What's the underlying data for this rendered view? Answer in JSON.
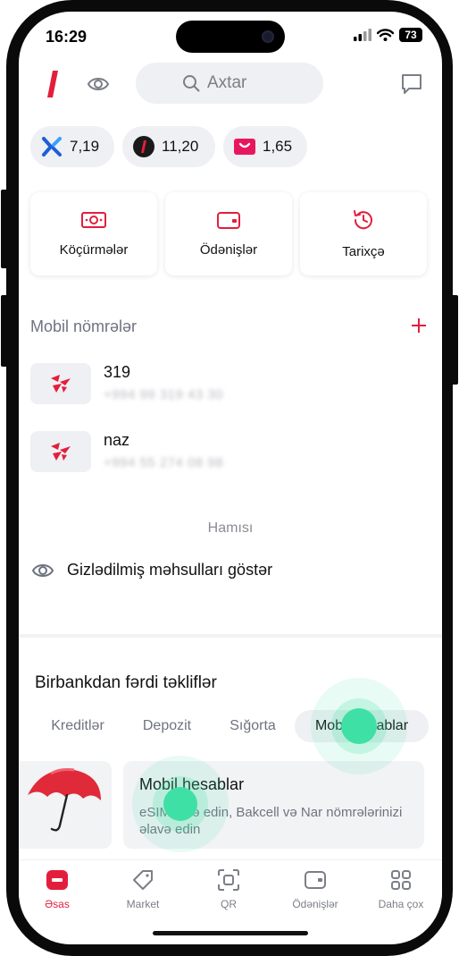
{
  "status_bar": {
    "time": "16:29",
    "battery": "73"
  },
  "header": {
    "logo_icon": "birbank-logo-icon",
    "visibility_icon": "eye-icon",
    "search_placeholder": "Axtar",
    "chat_icon": "chat-bubble-icon"
  },
  "balances": [
    {
      "icon": "crossing-arrows-icon",
      "value": "7,19"
    },
    {
      "icon": "birbank-round-icon",
      "value": "11,20"
    },
    {
      "icon": "red-gift-icon",
      "value": "1,65"
    }
  ],
  "actions": [
    {
      "label": "Köçürmələr",
      "icon": "money-transfer-icon"
    },
    {
      "label": "Ödənişlər",
      "icon": "wallet-icon"
    },
    {
      "label": "Tarixçə",
      "icon": "history-icon"
    }
  ],
  "mobile_numbers": {
    "title": "Mobil nömrələr",
    "items": [
      {
        "name": "319",
        "number": "+994 99 319 43 30"
      },
      {
        "name": "naz",
        "number": "+994 55 274 08 98"
      }
    ],
    "all_label": "Hamısı",
    "hidden_products_label": "Gizlədilmiş məhsulları göstər"
  },
  "offers": {
    "title": "Birbankdan fərdi təkliflər",
    "chips": [
      "Kreditlər",
      "Depozit",
      "Sığorta",
      "Mobil hesablar"
    ],
    "active_chip": "Mobil hesablar",
    "card_title": "Mobil hesablar",
    "card_desc": "eSIM əldə edin, Bakcell və Nar nömrələrinizi əlavə edin"
  },
  "tabbar": [
    {
      "label": "Əsas",
      "icon": "home-card-icon",
      "active": true
    },
    {
      "label": "Market",
      "icon": "tag-icon",
      "active": false
    },
    {
      "label": "QR",
      "icon": "qr-scan-icon",
      "active": false
    },
    {
      "label": "Ödənişlər",
      "icon": "wallet-icon",
      "active": false
    },
    {
      "label": "Daha çox",
      "icon": "grid-icon",
      "active": false
    }
  ],
  "colors": {
    "brand_red": "#e31e3c",
    "touch_green": "#3fe0a5",
    "pill_bg": "#eef0f3"
  }
}
